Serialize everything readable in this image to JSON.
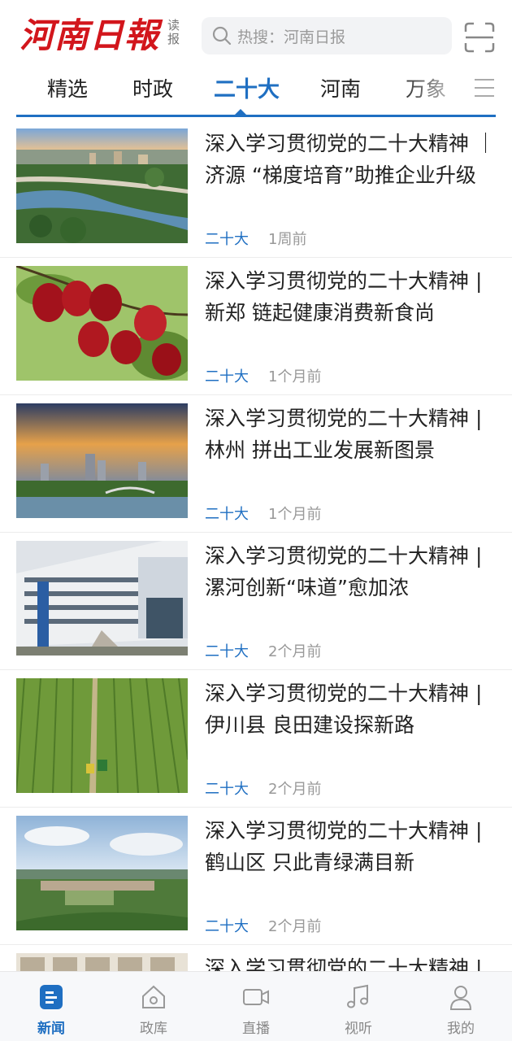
{
  "header": {
    "logo_text": "河南日報",
    "logo_sub_1": "读",
    "logo_sub_2": "报",
    "search_placeholder": "热搜：河南日报",
    "brand_color": "#d2161c"
  },
  "tabs": [
    {
      "label": "精选",
      "active": false
    },
    {
      "label": "时政",
      "active": false
    },
    {
      "label": "二十大",
      "active": true
    },
    {
      "label": "河南",
      "active": false
    },
    {
      "label": "万象",
      "active": false
    }
  ],
  "accent_color": "#1f6fc2",
  "articles": [
    {
      "title": "深入学习贯彻党的二十大精神 ｜济源 “梯度培育”助推企业升级",
      "tag": "二十大",
      "time": "1周前",
      "image": "city-river-aerial"
    },
    {
      "title": "深入学习贯彻党的二十大精神 | 新郑 链起健康消费新食尚",
      "tag": "二十大",
      "time": "1个月前",
      "image": "red-dates"
    },
    {
      "title": "深入学习贯彻党的二十大精神 | 林州 拼出工业发展新图景",
      "tag": "二十大",
      "time": "1个月前",
      "image": "city-skyline-sunset"
    },
    {
      "title": "深入学习贯彻党的二十大精神 | 漯河创新“味道”愈加浓",
      "tag": "二十大",
      "time": "2个月前",
      "image": "office-building"
    },
    {
      "title": "深入学习贯彻党的二十大精神 | 伊川县 良田建设探新路",
      "tag": "二十大",
      "time": "2个月前",
      "image": "farmland"
    },
    {
      "title": "深入学习贯彻党的二十大精神 | 鹤山区 只此青绿满目新",
      "tag": "二十大",
      "time": "2个月前",
      "image": "green-town"
    },
    {
      "title": "深入学习贯彻党的二十大精神 |",
      "tag": "",
      "time": "",
      "image": "interior"
    }
  ],
  "bottom_nav": [
    {
      "label": "新闻",
      "icon": "news-icon",
      "active": true
    },
    {
      "label": "政库",
      "icon": "home-icon",
      "active": false
    },
    {
      "label": "直播",
      "icon": "video-camera-icon",
      "active": false
    },
    {
      "label": "视听",
      "icon": "music-note-icon",
      "active": false
    },
    {
      "label": "我的",
      "icon": "user-icon",
      "active": false
    }
  ]
}
